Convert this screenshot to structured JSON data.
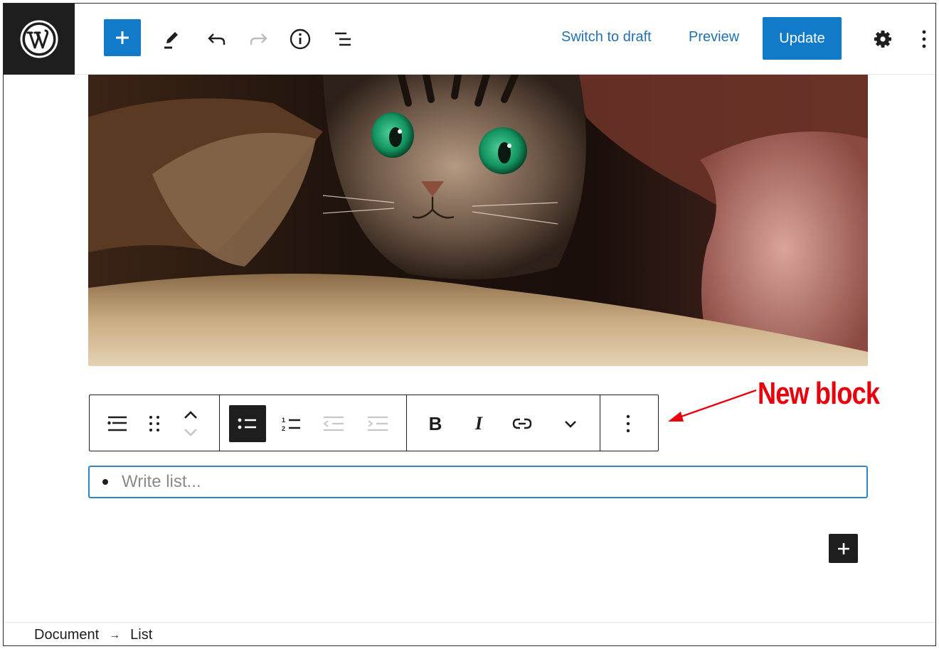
{
  "header": {
    "logo_icon": "wordpress-logo-icon",
    "switch_to_draft": "Switch to draft",
    "preview": "Preview",
    "update": "Update",
    "accent_color": "#117ac9",
    "tools": [
      "plus-icon",
      "pencil-icon",
      "undo-icon",
      "redo-icon",
      "info-icon",
      "list-view-icon",
      "gear-icon",
      "more-vertical-icon"
    ]
  },
  "image": {
    "icon": "cat-photo"
  },
  "block_toolbar": {
    "groups": [
      [
        "list-block-icon",
        "drag-handle-icon",
        "move-up-down-icon"
      ],
      [
        "unordered-list-icon",
        "ordered-list-icon",
        "outdent-icon",
        "indent-icon"
      ],
      [
        "bold-icon",
        "italic-icon",
        "link-icon",
        "chevron-down-icon"
      ],
      [
        "more-options-icon"
      ]
    ],
    "bold_label": "B",
    "italic_label": "I"
  },
  "annotation": {
    "text": "New block",
    "color": "#e8000d"
  },
  "list_block": {
    "placeholder": "Write list..."
  },
  "footer": {
    "breadcrumb": [
      "Document",
      "List"
    ],
    "separator": "→"
  }
}
